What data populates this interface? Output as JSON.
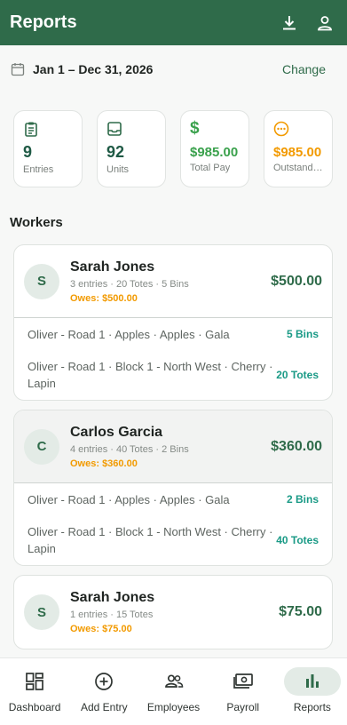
{
  "header": {
    "title": "Reports"
  },
  "range": {
    "text": "Jan 1 – Dec 31, 2026",
    "change_label": "Change"
  },
  "stats": [
    {
      "value": "9",
      "label": "Entries",
      "color": "#1f5a45",
      "icon": "clipboard-icon"
    },
    {
      "value": "92",
      "label": "Units",
      "color": "#1f5a45",
      "icon": "inbox-icon"
    },
    {
      "value": "$985.00",
      "label": "Total Pay",
      "color": "#3aa14c",
      "icon": "dollar-icon"
    },
    {
      "value": "$985.00",
      "label": "Outstandi...",
      "color": "#f29a00",
      "icon": "more-circle-icon"
    }
  ],
  "workers_title": "Workers",
  "workers": [
    {
      "initial": "S",
      "name": "Sarah Jones",
      "meta": "3 entries · 20 Totes · 5 Bins",
      "owes": "Owes: $500.00",
      "amount": "$500.00",
      "details": [
        {
          "desc": "Oliver - Road 1 · Apples · Apples · Gala",
          "qty": "5 Bins"
        },
        {
          "desc": "Oliver - Road 1 · Block 1 - North West · Cherry · Lapin",
          "qty": "20 Totes"
        }
      ]
    },
    {
      "initial": "C",
      "name": "Carlos Garcia",
      "meta": "4 entries · 40 Totes · 2 Bins",
      "owes": "Owes: $360.00",
      "amount": "$360.00",
      "details": [
        {
          "desc": "Oliver - Road 1 · Apples · Apples · Gala",
          "qty": "2 Bins"
        },
        {
          "desc": "Oliver - Road 1 · Block 1 - North West · Cherry · Lapin",
          "qty": "40 Totes"
        }
      ]
    },
    {
      "initial": "S",
      "name": "Sarah Jones",
      "meta": "1 entries · 15 Totes",
      "owes": "Owes: $75.00",
      "amount": "$75.00"
    }
  ],
  "nav": [
    {
      "label": "Dashboard",
      "icon": "dashboard-icon"
    },
    {
      "label": "Add Entry",
      "icon": "add-circle-icon"
    },
    {
      "label": "Employees",
      "icon": "people-icon"
    },
    {
      "label": "Payroll",
      "icon": "payroll-icon"
    },
    {
      "label": "Reports",
      "icon": "bar-chart-icon"
    }
  ]
}
